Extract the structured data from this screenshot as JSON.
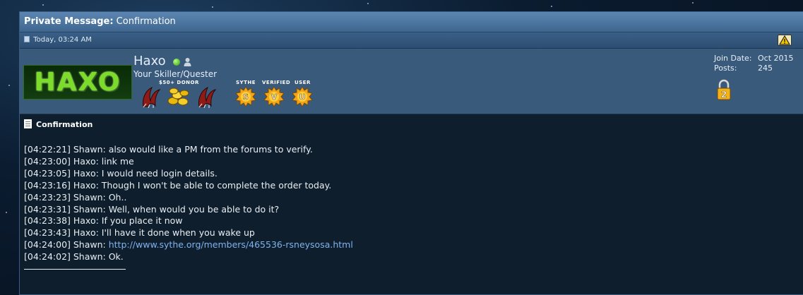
{
  "header": {
    "title_bold": "Private Message:",
    "title_rest": "Confirmation"
  },
  "post": {
    "date": "Today, 03:24 AM",
    "report_icon": "warning-icon"
  },
  "user": {
    "logo_text": "HAXO",
    "name": "Haxo",
    "title": "Your Skiller/Quester",
    "donor_label": "$50+ DONOR",
    "badge_labels": [
      "SYTHE",
      "VERIFIED",
      "USER"
    ],
    "sun_letters": [
      "S",
      "V",
      "U"
    ],
    "join_label": "Join Date:",
    "join_value": "Oct 2015",
    "posts_label": "Posts:",
    "posts_value": "245",
    "lock_number": "2"
  },
  "message": {
    "title": "Confirmation",
    "lines": [
      "[04:22:21] Shawn: also would like a PM from the forums to verify.",
      "[04:23:00] Haxo: link me",
      "[04:23:05] Haxo: I would need login details.",
      "[04:23:16] Haxo: Though I won't be able to complete the order today.",
      "[04:23:23] Shawn: Oh..",
      "[04:23:31] Shawn: Well, when would you be able to do it?",
      "[04:23:38] Haxo: If you place it now",
      "[04:23:43] Haxo: I'll have it done when you wake up"
    ],
    "link_prefix": "[04:24:00] Shawn: ",
    "link_text": "http://www.sythe.org/members/465536-rsneysosa.html",
    "last_line": "[04:24:02] Shawn: Ok."
  },
  "colors": {
    "link": "#7fb2ee",
    "titlebar": "#4f79a4",
    "body_bg": "#0f1e2d"
  }
}
